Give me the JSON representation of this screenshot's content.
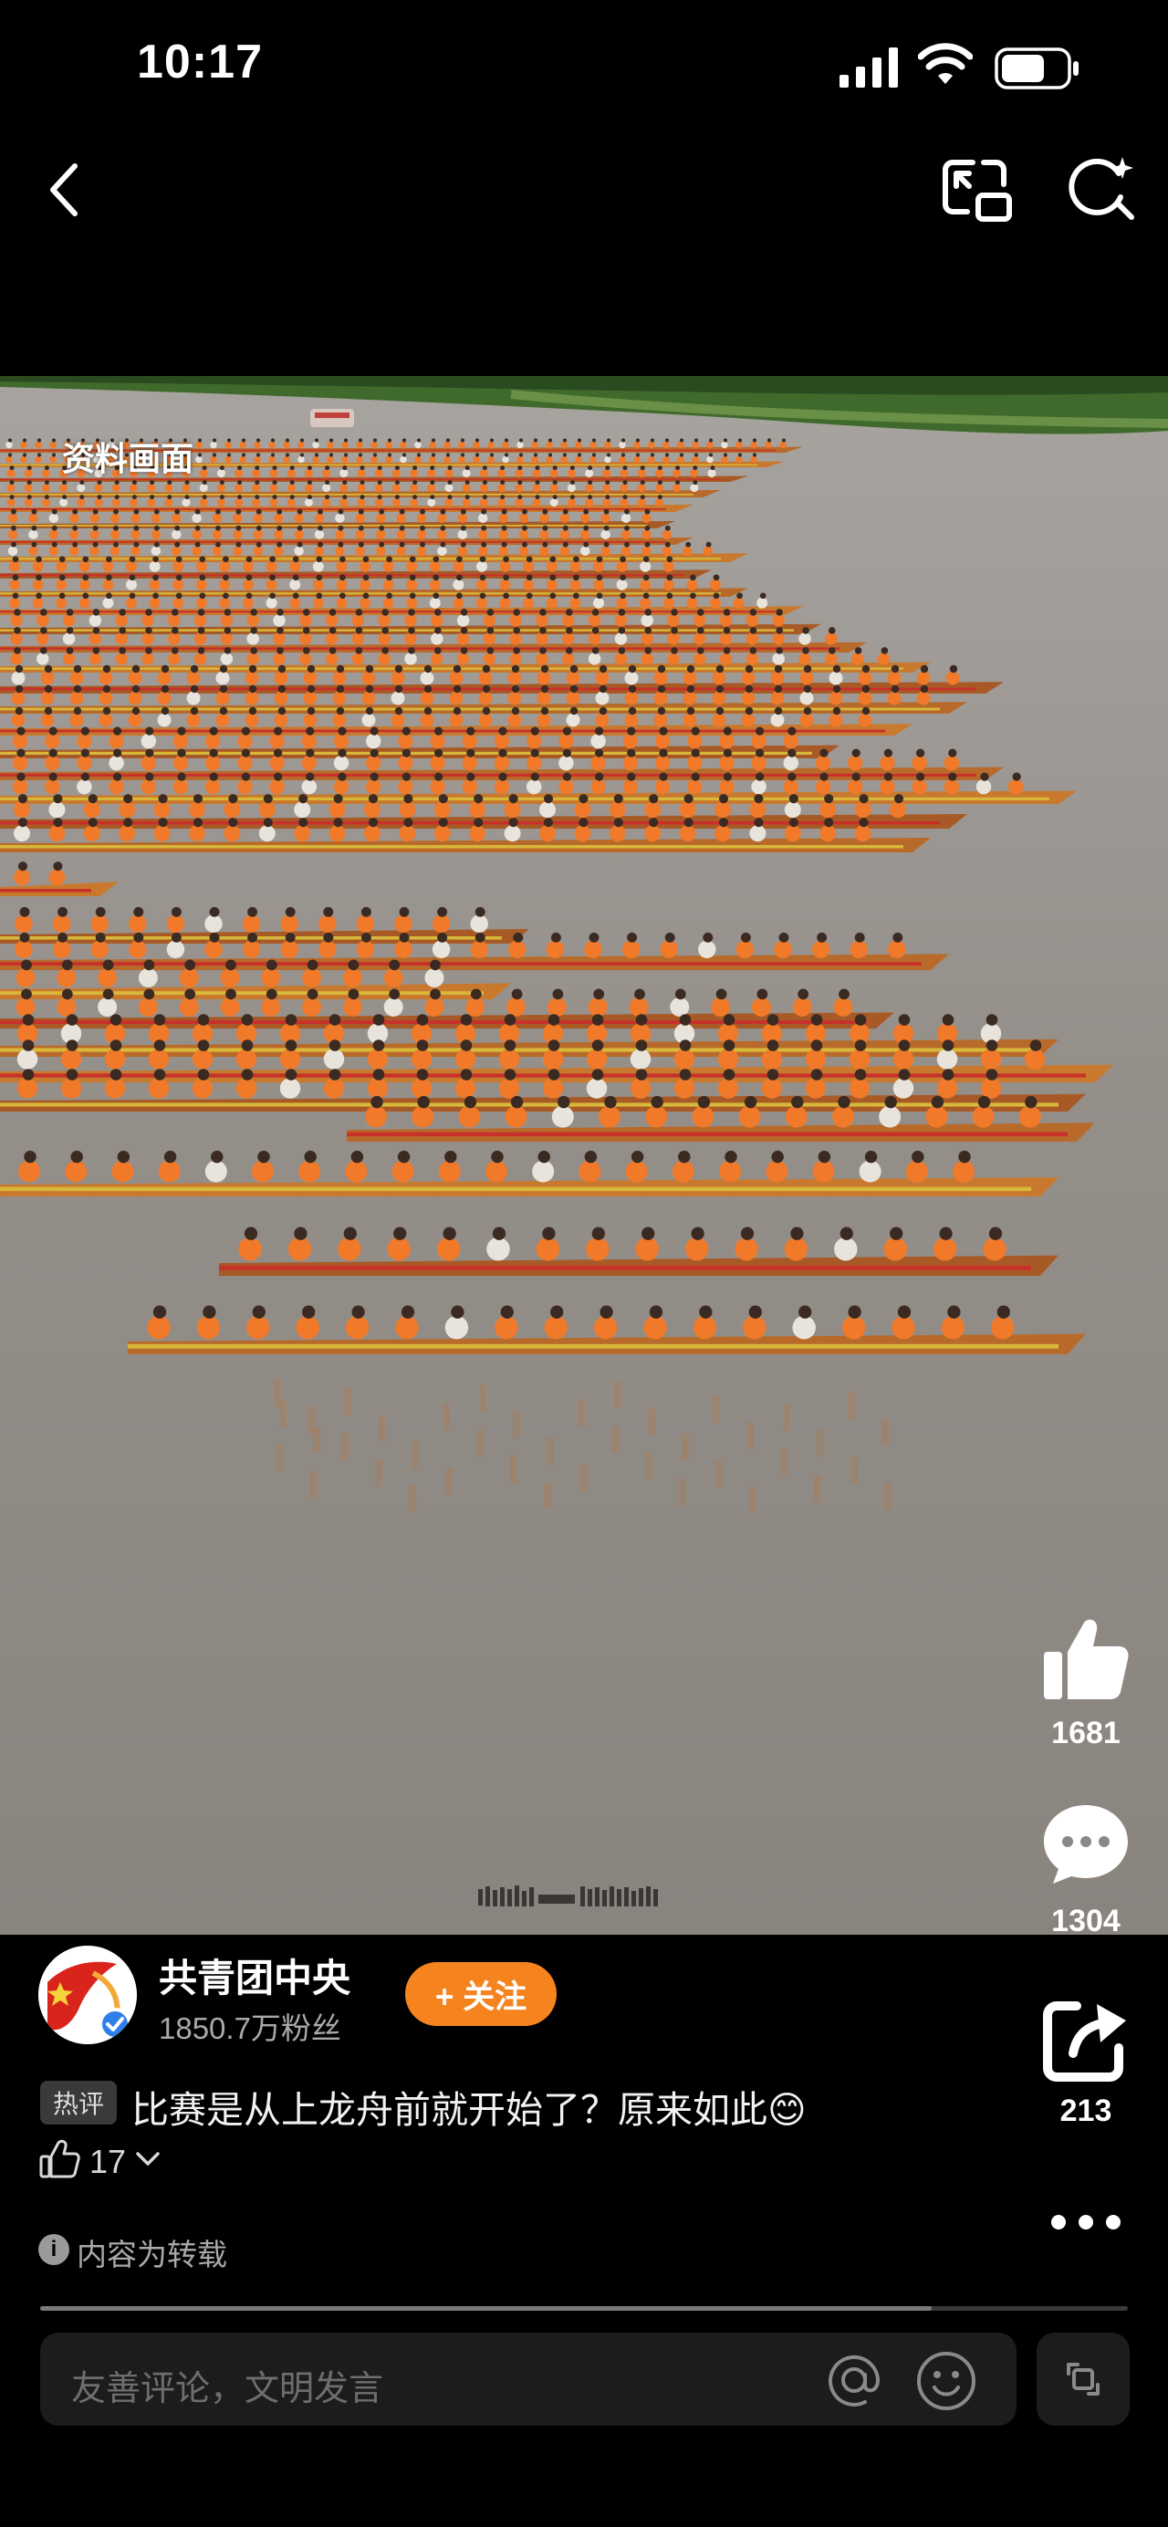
{
  "status_bar": {
    "time": "10:17"
  },
  "video": {
    "caption": "资料画面"
  },
  "actions": {
    "like_count": "1681",
    "comment_count": "1304",
    "share_count": "213"
  },
  "author": {
    "name": "共青团中央",
    "fans": "1850.7万粉丝",
    "follow_label": "+ 关注"
  },
  "hot_comment": {
    "badge": "热评",
    "text": "比赛是从上龙舟前就开始了？原来如此😊",
    "like_count": "17"
  },
  "repost_notice": {
    "label": "内容为转载"
  },
  "playback": {
    "progress": 0.82
  },
  "comment_box": {
    "placeholder": "友善评论，文明发言"
  },
  "colors": {
    "follow_button": "#f5841f",
    "background": "#000000",
    "water": "#8f8a86",
    "rower_shirt": "#f07a2a"
  }
}
